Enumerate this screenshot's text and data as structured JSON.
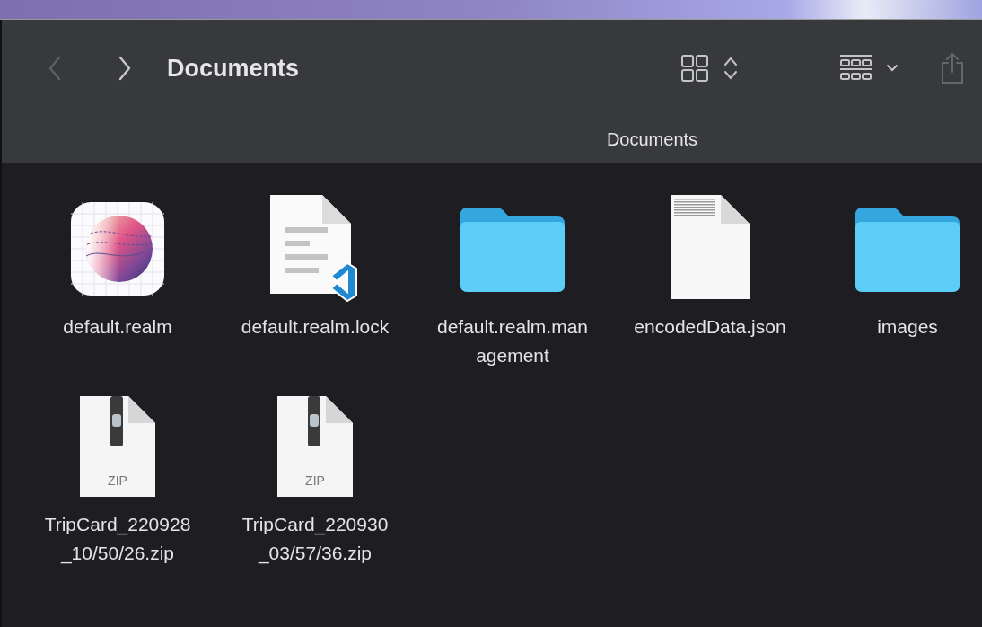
{
  "toolbar": {
    "back": {
      "disabled": true
    },
    "forward": {
      "disabled": false
    },
    "title": "Documents",
    "share": {
      "disabled": true
    }
  },
  "path_bar": {
    "label": "Documents"
  },
  "items": [
    {
      "kind": "app",
      "lines": [
        "default.realm"
      ]
    },
    {
      "kind": "code-doc",
      "lines": [
        "default.realm.lock"
      ]
    },
    {
      "kind": "folder",
      "lines": [
        "default.realm.man",
        "agement"
      ]
    },
    {
      "kind": "text-doc",
      "lines": [
        "encodedData.json"
      ]
    },
    {
      "kind": "folder",
      "lines": [
        "images"
      ]
    },
    {
      "kind": "zip",
      "badge": "ZIP",
      "lines": [
        "TripCard_220928",
        "_10/50/26.zip"
      ]
    },
    {
      "kind": "zip",
      "badge": "ZIP",
      "lines": [
        "TripCard_220930",
        "_03/57/36.zip"
      ]
    }
  ]
}
